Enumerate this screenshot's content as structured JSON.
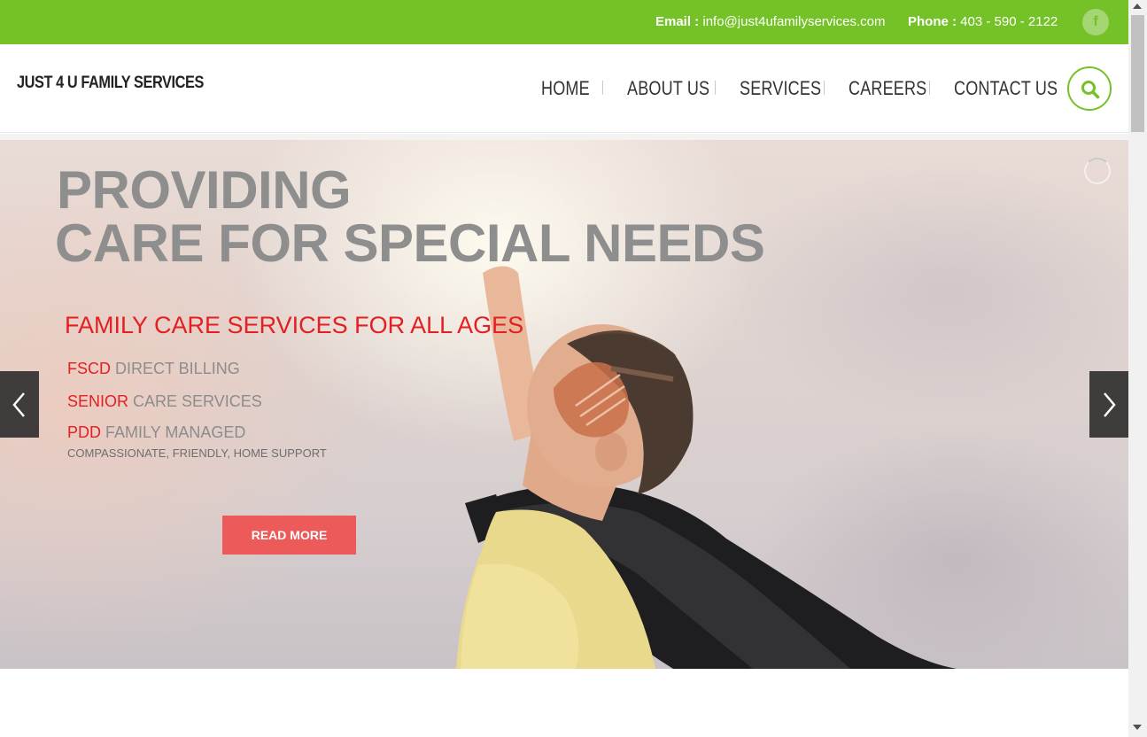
{
  "topbar": {
    "email_label": "Email :",
    "email_value": "info@just4ufamilyservices.com",
    "phone_label": "Phone :",
    "phone_value": "403 - 590 - 2122",
    "facebook_glyph": "f",
    "facebook_icon": "facebook-icon"
  },
  "header": {
    "logo_text": "JUST 4 U FAMILY SERVICES",
    "nav": [
      "HOME",
      "ABOUT US",
      "SERVICES",
      "CAREERS",
      "CONTACT US"
    ],
    "search_icon": "search-icon"
  },
  "hero": {
    "title_line1": "PROVIDING",
    "title_line2": "CARE FOR SPECIAL NEEDS",
    "subtitle": "FAMILY CARE SERVICES FOR ALL AGES",
    "features": [
      {
        "highlight": "FSCD",
        "rest": " DIRECT BILLING"
      },
      {
        "highlight": "SENIOR",
        "rest": " CARE SERVICES"
      },
      {
        "highlight": "PDD",
        "rest": " FAMILY MANAGED"
      }
    ],
    "tagline": "COMPASSIONATE, FRIENDLY, HOME SUPPORT",
    "button_label": "READ MORE",
    "prev_icon": "chevron-left-icon",
    "next_icon": "chevron-right-icon"
  },
  "colors": {
    "brand_green": "#74c228",
    "accent_red": "#e41f22",
    "button_red": "#ec5a5a",
    "title_gray": "#8e8e8e"
  }
}
